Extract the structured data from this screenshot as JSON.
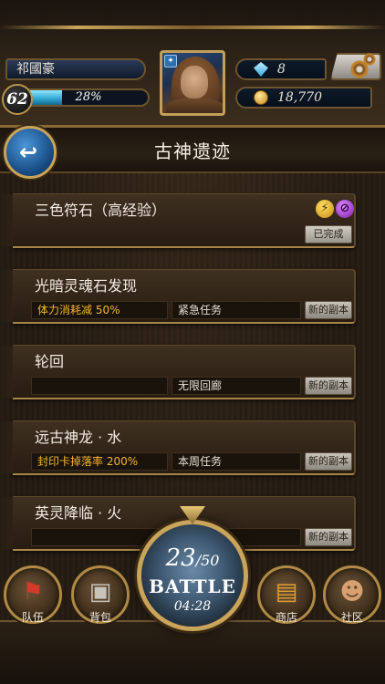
{
  "header": {
    "player_name": "祁國豪",
    "level": "62",
    "exp_percent": "28%",
    "exp_fraction": 0.28,
    "gems": "8",
    "gold": "18,770"
  },
  "page": {
    "title": "古神遗迹"
  },
  "quests": [
    {
      "title": "三色符石（高经验）",
      "buff": "",
      "type": "",
      "badge": "已完成",
      "element_icons": [
        "light-element-icon",
        "dark-element-icon"
      ]
    },
    {
      "title": "光暗灵魂石发现",
      "buff": "体力消耗减 50%",
      "type": "紧急任务",
      "badge": "新的副本"
    },
    {
      "title": "轮回",
      "buff": "",
      "type": "无限回廊",
      "badge": "新的副本"
    },
    {
      "title": "远古神龙 · 水",
      "buff": "封印卡掉落率 200%",
      "type": "本周任务",
      "badge": "新的副本"
    },
    {
      "title": "英灵降临 · 火",
      "buff": "",
      "type": "",
      "badge": "新的副本"
    }
  ],
  "battle": {
    "stamina_current": "23",
    "stamina_max": "/50",
    "label": "BATTLE",
    "timer": "04:28"
  },
  "nav": {
    "team": "队伍",
    "bag": "背包",
    "shop": "商店",
    "community": "社区"
  },
  "colors": {
    "buff_text": "#f5b52a",
    "exp_bar": "#2fa5cf",
    "gold_trim": "#c9a45a"
  }
}
